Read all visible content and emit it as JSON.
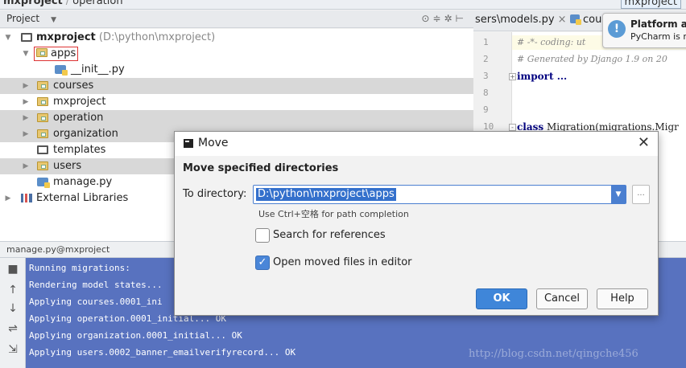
{
  "breadcrumb": {
    "project": "mxproject",
    "folder": "operation",
    "right_tab": "mxproject"
  },
  "project_panel": {
    "title": "Project",
    "tree": [
      {
        "label": "mxproject",
        "path": "(D:\\python\\mxproject)"
      },
      {
        "label": "apps"
      },
      {
        "label": "__init__.py"
      },
      {
        "label": "courses"
      },
      {
        "label": "mxproject"
      },
      {
        "label": "operation"
      },
      {
        "label": "organization"
      },
      {
        "label": "templates"
      },
      {
        "label": "users"
      },
      {
        "label": "manage.py"
      },
      {
        "label": "External Libraries"
      }
    ]
  },
  "editor": {
    "tabs": [
      {
        "label": "sers\\models.py"
      },
      {
        "label": "cou"
      }
    ],
    "lines": [
      {
        "num": "1",
        "text": "# -*- coding: ut"
      },
      {
        "num": "2",
        "text": "# Generated by Django 1.9 on 20"
      },
      {
        "num": "3",
        "text": "import ..."
      },
      {
        "num": "8",
        "text": ""
      },
      {
        "num": "9",
        "text": ""
      },
      {
        "num": "10",
        "kw": "class",
        "text": " Migration(migrations.Migr"
      }
    ]
  },
  "notification": {
    "icon": "!",
    "title": "Platform ar",
    "body": "PyCharm is r"
  },
  "run_panel": {
    "title": "manage.py@mxproject",
    "lines": [
      "Running migrations:",
      "  Rendering model states...",
      "  Applying courses.0001_ini",
      "  Applying operation.0001_initial... OK",
      "  Applying organization.0001_initial... OK",
      "  Applying users.0002_banner_emailverifyrecord... OK"
    ],
    "watermark": "http://blog.csdn.net/qingche456"
  },
  "dialog": {
    "title": "Move",
    "close": "✕",
    "heading": "Move specified directories",
    "directory_label": "To directory:",
    "directory_value": "D:\\python\\mxproject\\apps",
    "browse_label": "...",
    "hint": "Use Ctrl+空格 for path completion",
    "search_references": {
      "label": "Search for references",
      "checked": false
    },
    "open_in_editor": {
      "label": "Open moved files in editor",
      "checked": true
    },
    "buttons": {
      "ok": "OK",
      "cancel": "Cancel",
      "help": "Help"
    }
  },
  "colors": {
    "accent": "#3f86d9",
    "console_bg": "#5872bf",
    "selection": "#d8d8d8"
  }
}
